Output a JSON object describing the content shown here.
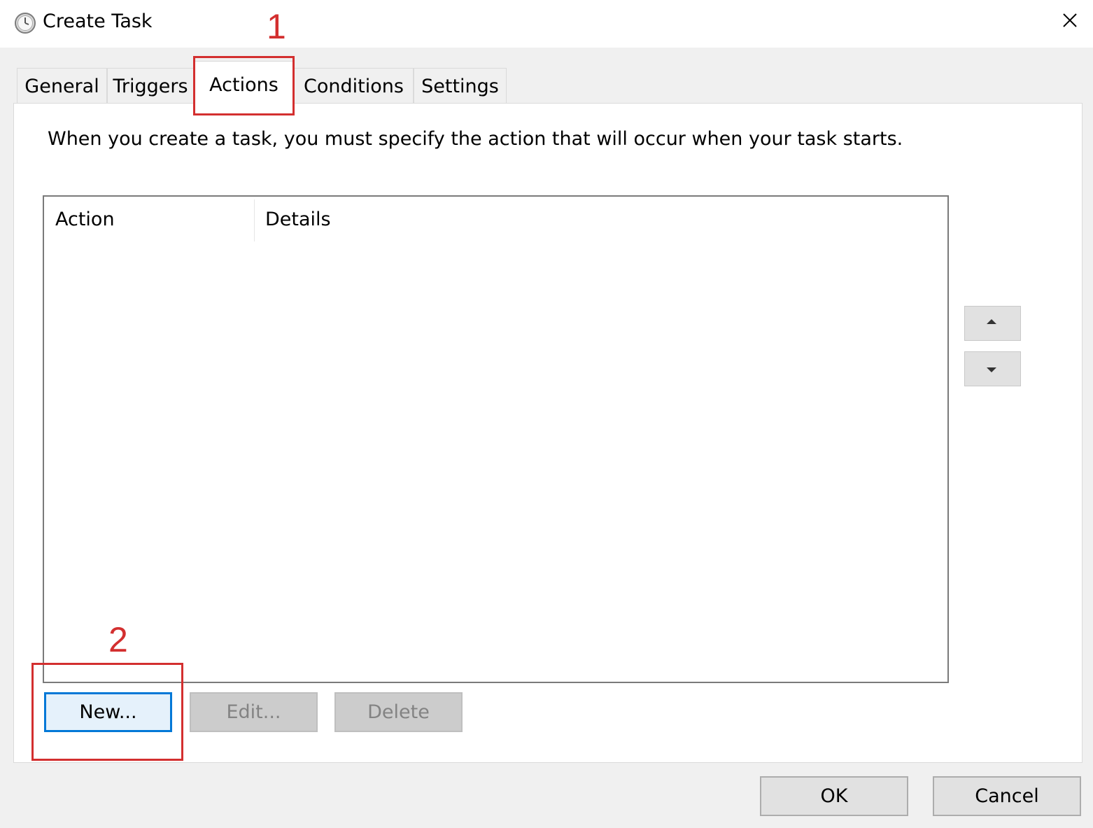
{
  "window": {
    "title": "Create Task",
    "app_icon": "task-scheduler-clock-icon",
    "close_icon": "close-icon"
  },
  "tabs": [
    {
      "label": "General",
      "active": false
    },
    {
      "label": "Triggers",
      "active": false
    },
    {
      "label": "Actions",
      "active": true
    },
    {
      "label": "Conditions",
      "active": false
    },
    {
      "label": "Settings",
      "active": false
    }
  ],
  "actions_panel": {
    "instruction": "When you create a task, you must specify the action that will occur when your task starts.",
    "list": {
      "columns": [
        "Action",
        "Details"
      ],
      "rows": []
    },
    "move_up_icon": "triangle-up-icon",
    "move_down_icon": "triangle-down-icon",
    "buttons": {
      "new": "New...",
      "edit": "Edit...",
      "delete": "Delete"
    }
  },
  "footer": {
    "ok": "OK",
    "cancel": "Cancel"
  },
  "annotations": [
    {
      "number": "1",
      "target": "Actions tab",
      "color": "#d32f2f"
    },
    {
      "number": "2",
      "target": "New... button",
      "color": "#d32f2f"
    }
  ],
  "colors": {
    "accent_focus": "#0078d7",
    "annotation_red": "#d32f2f",
    "window_bg": "#f0f0f0"
  }
}
